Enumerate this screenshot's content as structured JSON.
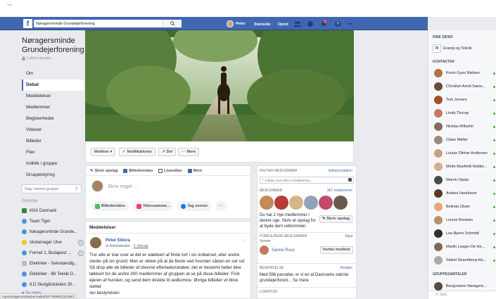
{
  "topbar": {
    "search_value": "Nøragersminde Grundejerforening",
    "profile_name": "Peter",
    "home_label": "Startside",
    "create_label": "Opret",
    "notif_count": "1"
  },
  "group": {
    "name": "Nøragersminde Grundejerforening",
    "type": "Lukket gruppe"
  },
  "left_menu": [
    "Om",
    "Debat",
    "Meddelelser",
    "Medlemmer",
    "Begivenheder",
    "Videoer",
    "Billeder",
    "Filer",
    "Indblik i gruppe",
    "Gruppestyring"
  ],
  "group_search_placeholder": "Søg i denne gruppe",
  "groups_heading": "Genveje",
  "groups": [
    {
      "name": "KNX Danmark",
      "color": "#2d8a3e",
      "count": ""
    },
    {
      "name": "Team Tiger",
      "color": "#4a90e2",
      "count": ""
    },
    {
      "name": "Nøragersminde Grunde...",
      "color": "#4a90e2",
      "count": ""
    },
    {
      "name": "Vestamager Ulve",
      "color": "#f5c518",
      "count": "1"
    },
    {
      "name": "Formel 1, Budapest ...",
      "color": "#4a90e2",
      "count": "1"
    },
    {
      "name": "Elektriker - Selvstændig...",
      "color": "#bbbbbb",
      "count": ""
    },
    {
      "name": "Elektriker - IBI Teknik D...",
      "color": "#4a90e2",
      "count": ""
    },
    {
      "name": "8.D Skolgårdskolen 20...",
      "color": "#4a90e2",
      "count": ""
    }
  ],
  "see_more": "Se mere",
  "cover_actions": {
    "member": "Medlem",
    "notifications": "Notifikationer",
    "share": "Del",
    "more": "Mere"
  },
  "composer": {
    "tab_post": "Skriv opslag",
    "tab_photo": "Billede/video",
    "tab_live": "Livevideo",
    "tab_more": "Mere",
    "placeholder": "Skriv noget ...",
    "chip_photo": "Billede/video",
    "chip_album": "Videosamme...",
    "chip_tag": "Tag venner",
    "chip_more": "···"
  },
  "announcements": {
    "title": "Meddelelser",
    "author": "Peter Sikora",
    "role": "Administrator",
    "date": "3. februar",
    "text": "Tror alle er klar over at det er ulækkert af finde lort i sin indkørsel, eller andre steder på sin grund. Men er sikker på at de fleste ved hvordan sådan en ser ud. Så drop alle de billeder af diverse efterladenskaber, det er bestemt heller ikke lækkert for de andre 300 medlemmer af gruppen at se på disse billeder. Find ejeren af hunden, og send dem direkte til vedkomne. Øvrige billeder vil blive slettet",
    "signoff": "/en bestyrelsen"
  },
  "right_panel": {
    "invite_heading": "INVITER MEDLEMMER",
    "invite_link": "Indkøj invitation",
    "invite_placeholder": "Indtast navn eller e-mailadresse...",
    "members_heading": "MEDLEMMER",
    "members_count": "367 medlemmer",
    "new_members_text": "Du har 2 nye medlemmer i denne uge. Skriv et opslag for at byde dem velkommen.",
    "write_post_btn": "Skriv opslag",
    "suggested_heading": "FORESLÅEDE MEDLEMMER",
    "suggested_hide": "Skjul",
    "suggested_sub": "Venner",
    "suggested_name": "Sanne Russ",
    "invite_btn": "Inviter medlem",
    "desc_heading": "BESKRIVELSE",
    "desc_edit": "Rediger",
    "desc_text": "Med 596 parceller, er vi en af Danmarks største grundejerforeni... Se mere",
    "location_heading": "LOKATION"
  },
  "right_sidebar": {
    "pages_heading": "DINE SIDER",
    "page_name": "Energi og Teknik",
    "contacts_heading": "KONTAKTER",
    "contacts": [
      {
        "name": "Kevin Gyes Nielsen",
        "color": "#b0704a"
      },
      {
        "name": "Christian Arndi Sams...",
        "color": "#6b4a3a"
      },
      {
        "name": "Tom Jensen",
        "color": "#a0502a"
      },
      {
        "name": "Linda Thorup",
        "color": "#c47a5a"
      },
      {
        "name": "Nicklas Riftselm",
        "color": "#8b6b5a"
      },
      {
        "name": "Claes Møller",
        "color": "#9a8a7a"
      },
      {
        "name": "Louise Ditmar Andersen",
        "color": "#c9a37a"
      },
      {
        "name": "Mette Musfeldt Nebbe...",
        "color": "#d4b08a"
      },
      {
        "name": "Warrin Opala",
        "color": "#4a4a4a"
      },
      {
        "name": "Anders Henriksen",
        "color": "#5a3a2a"
      },
      {
        "name": "Belinda Olsen",
        "color": "#e8a57a"
      },
      {
        "name": "Lonnie Bentsen",
        "color": "#b89070"
      },
      {
        "name": "Lea Bjerre Schmidt",
        "color": "#3a2a2a"
      },
      {
        "name": "Martin Lyager De He...",
        "color": "#7a6a5a"
      },
      {
        "name": "Sidsel Strandberg-Ha...",
        "color": "#aaaaaa"
      }
    ],
    "group_chats_heading": "GRUPPESAMTALER",
    "group_chat_name": "Bestyrelsen Nøragers...",
    "search_placeholder": "Søg"
  },
  "status_url": "rups/noragersminde/permalink/207780952231169?/"
}
